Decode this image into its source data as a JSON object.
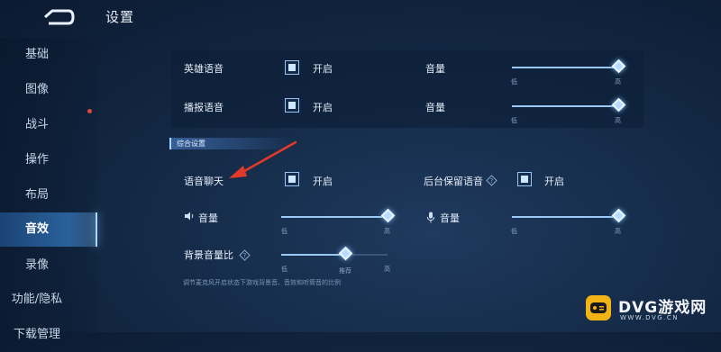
{
  "header": {
    "title": "设置"
  },
  "sidebar": {
    "items": [
      {
        "label": "基础"
      },
      {
        "label": "图像"
      },
      {
        "label": "战斗"
      },
      {
        "label": "操作"
      },
      {
        "label": "布局"
      },
      {
        "label": "音效"
      },
      {
        "label": "录像"
      },
      {
        "label": "功能/隐私"
      },
      {
        "label": "下载管理"
      }
    ],
    "active_index": 5
  },
  "voice_panel": {
    "rows": [
      {
        "label": "英雄语音",
        "toggle": "开启",
        "volume_label": "音量",
        "low": "低",
        "high": "高",
        "volume": 1.0
      },
      {
        "label": "播报语音",
        "toggle": "开启",
        "volume_label": "音量",
        "low": "低",
        "high": "高",
        "volume": 1.0
      }
    ]
  },
  "general": {
    "section_title": "综合设置",
    "voice_chat": {
      "label": "语音聊天",
      "toggle": "开启"
    },
    "background_keep": {
      "label": "后台保留语音",
      "toggle": "开启"
    },
    "speaker_volume": {
      "label": "音量",
      "low": "低",
      "high": "高",
      "volume": 1.0
    },
    "mic_volume": {
      "label": "音量",
      "low": "低",
      "high": "高",
      "volume": 1.0
    },
    "bg_ratio": {
      "label": "背景音量比",
      "low": "低",
      "recommend": "推荐",
      "high": "高",
      "value": 0.6
    },
    "footnote": "调节麦克风开启状态下游戏背景音、音效和听筒音的比例"
  },
  "watermark": {
    "text": "DVG游戏网",
    "url": "WWW.DVG.CN"
  },
  "colors": {
    "accent": "#a8d8ff",
    "arrow": "#e23a2a",
    "badge": "#e0453a"
  }
}
